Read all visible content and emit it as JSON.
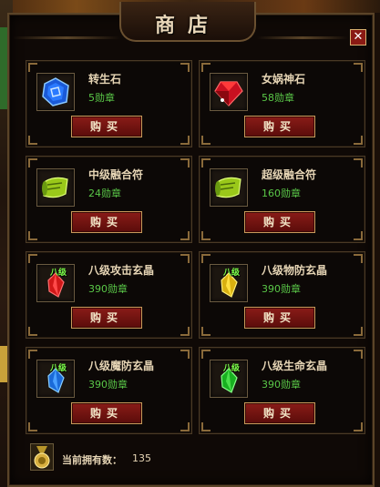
{
  "shop": {
    "title": "商店",
    "close_label": "✕",
    "items": [
      {
        "name": "转生石",
        "price": "5勋章",
        "buy_label": "购买",
        "icon": "blue-rune-stone-icon"
      },
      {
        "name": "女娲神石",
        "price": "58勋章",
        "buy_label": "购买",
        "icon": "red-gem-icon"
      },
      {
        "name": "中级融合符",
        "price": "24勋章",
        "buy_label": "购买",
        "icon": "green-scroll-icon"
      },
      {
        "name": "超级融合符",
        "price": "160勋章",
        "buy_label": "购买",
        "icon": "green-scroll-icon"
      },
      {
        "name": "八级攻击玄晶",
        "price": "390勋章",
        "buy_label": "购买",
        "icon": "red-crystal-icon",
        "tag": "八级"
      },
      {
        "name": "八级物防玄晶",
        "price": "390勋章",
        "buy_label": "购买",
        "icon": "yellow-crystal-icon",
        "tag": "八级"
      },
      {
        "name": "八级魔防玄晶",
        "price": "390勋章",
        "buy_label": "购买",
        "icon": "blue-crystal-icon",
        "tag": "八级"
      },
      {
        "name": "八级生命玄晶",
        "price": "390勋章",
        "buy_label": "购买",
        "icon": "green-crystal-icon",
        "tag": "八级"
      }
    ],
    "footer": {
      "label": "当前拥有数：",
      "value": "135",
      "icon": "medal-icon"
    }
  },
  "colors": {
    "price": "#5ac848",
    "buy_button": "#8a1c18",
    "name": "#e6d5b5"
  }
}
